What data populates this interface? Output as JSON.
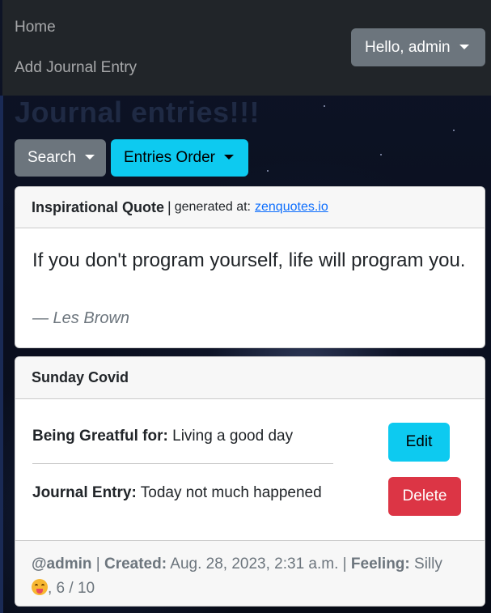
{
  "nav": {
    "links": [
      "Home",
      "Add Journal Entry"
    ],
    "user_menu": "Hello, admin"
  },
  "page": {
    "title": "Journal entries!!!"
  },
  "toolbar": {
    "search_label": "Search",
    "order_label": "Entries Order"
  },
  "quote_card": {
    "header_title": "Inspirational Quote",
    "separator": "|",
    "generated_label": "generated at:",
    "source_link": "zenquotes.io",
    "quote": "If you don't program yourself, life will program you.",
    "author": "— Les Brown"
  },
  "entry": {
    "title": "Sunday Covid",
    "greatful_label": "Being Greatful for:",
    "greatful_value": "Living a good day",
    "journal_label": "Journal Entry:",
    "journal_value": "Today not much happened",
    "edit_label": "Edit",
    "delete_label": "Delete",
    "footer": {
      "user": "@admin",
      "sep": "|",
      "created_label": "Created:",
      "created_value": "Aug. 28, 2023, 2:31 a.m.",
      "feeling_label": "Feeling:",
      "feeling_value": "Silly",
      "rating": ", 6 / 10",
      "emoji_icon": "silly-face-emoji"
    }
  },
  "colors": {
    "navbar": "#212529",
    "secondary": "#6c757d",
    "info": "#0dcaf0",
    "danger": "#dc3545",
    "link": "#0d6efd"
  }
}
